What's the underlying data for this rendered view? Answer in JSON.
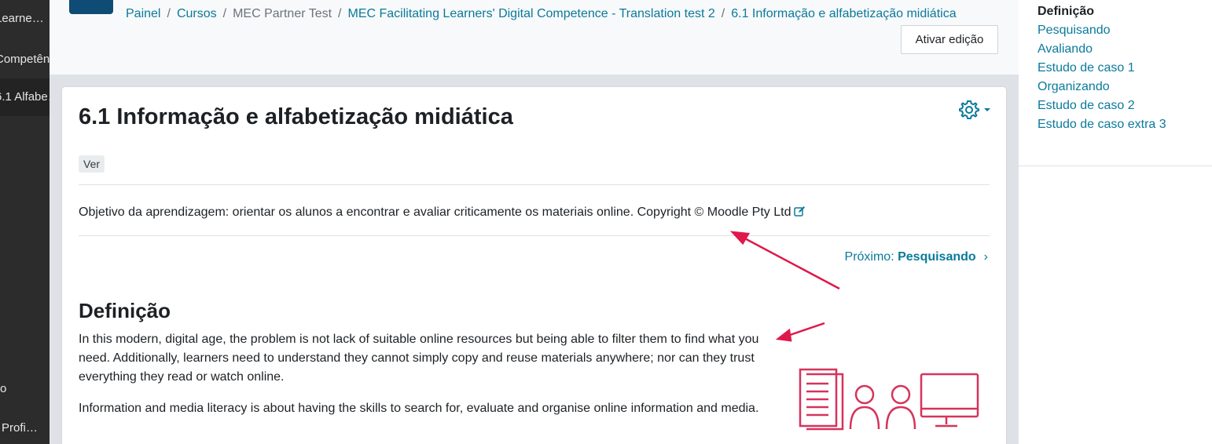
{
  "drawer": {
    "items": [
      {
        "label": "Learne…",
        "active": false
      },
      {
        "label": "Competên…",
        "active": false
      },
      {
        "label": "6.1 Alfabe…",
        "active": true
      },
      {
        "label": "o",
        "active": false
      },
      {
        "label": "Profi…",
        "active": false
      }
    ]
  },
  "header": {
    "breadcrumb": [
      {
        "label": "Painel",
        "link": true
      },
      {
        "label": "Cursos",
        "link": true
      },
      {
        "label": "MEC Partner Test",
        "link": false
      },
      {
        "label": "MEC Facilitating Learners' Digital Competence - Translation test 2",
        "link": true
      },
      {
        "label": "6.1 Informação e alfabetização midiática",
        "link": true
      }
    ],
    "edit_button": "Ativar edição"
  },
  "page": {
    "title": "6.1 Informação e alfabetização midiática",
    "tag": "Ver",
    "objective": "Objetivo da aprendizagem: orientar os alunos a encontrar e avaliar criticamente os materiais online. Copyright © Moodle Pty Ltd",
    "next_prefix": "Próximo:",
    "next_target": "Pesquisando",
    "next_chevron": "›",
    "section_heading": "Definição",
    "paragraph1": "In this modern, digital age, the problem is not lack of suitable online resources but being able to filter them to find what you need. Additionally, learners need to understand they cannot simply copy and reuse materials anywhere; nor can they trust everything they read or watch online.",
    "paragraph2": "Information and media literacy is about having the skills to search for, evaluate and organise online information and media."
  },
  "toc": {
    "items": [
      {
        "label": "Definição",
        "current": true
      },
      {
        "label": "Pesquisando",
        "current": false
      },
      {
        "label": "Avaliando",
        "current": false
      },
      {
        "label": "Estudo de caso 1",
        "current": false
      },
      {
        "label": "Organizando",
        "current": false
      },
      {
        "label": "Estudo de caso 2",
        "current": false
      },
      {
        "label": "Estudo de caso extra 3",
        "current": false
      }
    ]
  },
  "colors": {
    "link": "#0a7a9b",
    "annotation_arrow": "#e0174a",
    "illustration": "#d6335b",
    "drawer_bg": "#2c2c2c"
  }
}
